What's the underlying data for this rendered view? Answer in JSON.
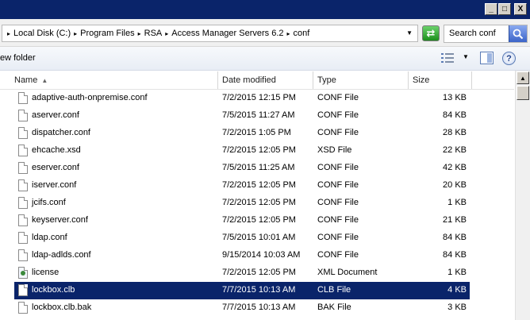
{
  "window": {
    "buttons": [
      {
        "glyph": "_"
      },
      {
        "glyph": "□"
      },
      {
        "glyph": "X"
      }
    ]
  },
  "address": {
    "breadcrumbs": [
      {
        "label": "Local Disk (C:)"
      },
      {
        "label": "Program Files"
      },
      {
        "label": "RSA"
      },
      {
        "label": "Access Manager Servers 6.2"
      },
      {
        "label": "conf"
      }
    ],
    "search_placeholder": "Search conf"
  },
  "toolbar": {
    "new_folder_label": "ew folder"
  },
  "columns": {
    "name": "Name",
    "date_modified": "Date modified",
    "type": "Type",
    "size": "Size"
  },
  "files": [
    {
      "name": "adaptive-auth-onpremise.conf",
      "date": "7/2/2015 12:15 PM",
      "type": "CONF File",
      "size": "13 KB",
      "icon": "file-icon"
    },
    {
      "name": "aserver.conf",
      "date": "7/5/2015 11:27 AM",
      "type": "CONF File",
      "size": "84 KB",
      "icon": "file-icon"
    },
    {
      "name": "dispatcher.conf",
      "date": "7/2/2015 1:05 PM",
      "type": "CONF File",
      "size": "28 KB",
      "icon": "file-icon"
    },
    {
      "name": "ehcache.xsd",
      "date": "7/2/2015 12:05 PM",
      "type": "XSD File",
      "size": "22 KB",
      "icon": "file-icon"
    },
    {
      "name": "eserver.conf",
      "date": "7/5/2015 11:25 AM",
      "type": "CONF File",
      "size": "42 KB",
      "icon": "file-icon"
    },
    {
      "name": "iserver.conf",
      "date": "7/2/2015 12:05 PM",
      "type": "CONF File",
      "size": "20 KB",
      "icon": "file-icon"
    },
    {
      "name": "jcifs.conf",
      "date": "7/2/2015 12:05 PM",
      "type": "CONF File",
      "size": "1 KB",
      "icon": "file-icon"
    },
    {
      "name": "keyserver.conf",
      "date": "7/2/2015 12:05 PM",
      "type": "CONF File",
      "size": "21 KB",
      "icon": "file-icon"
    },
    {
      "name": "ldap.conf",
      "date": "7/5/2015 10:01 AM",
      "type": "CONF File",
      "size": "84 KB",
      "icon": "file-icon"
    },
    {
      "name": "ldap-adlds.conf",
      "date": "9/15/2014 10:03 AM",
      "type": "CONF File",
      "size": "84 KB",
      "icon": "file-icon"
    },
    {
      "name": "license",
      "date": "7/2/2015 12:05 PM",
      "type": "XML Document",
      "size": "1 KB",
      "icon": "xml-file-icon"
    },
    {
      "name": "lockbox.clb",
      "date": "7/7/2015 10:13 AM",
      "type": "CLB File",
      "size": "4 KB",
      "icon": "file-icon",
      "selected": true
    },
    {
      "name": "lockbox.clb.bak",
      "date": "7/7/2015 10:13 AM",
      "type": "BAK File",
      "size": "3 KB",
      "icon": "file-icon"
    }
  ],
  "colors": {
    "titlebar": "#0a246a",
    "selection": "#0a246a"
  }
}
